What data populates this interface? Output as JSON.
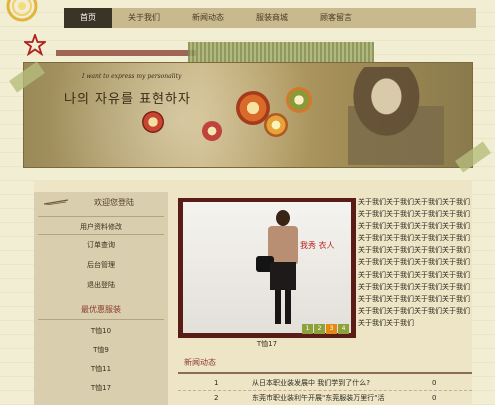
{
  "nav": {
    "items": [
      "首页",
      "关于我们",
      "新闻动态",
      "服装商城",
      "顾客留言"
    ]
  },
  "banner": {
    "tagline_small": "I want to express my personality",
    "tagline": "나의 자유를 표현하자"
  },
  "sidebar": {
    "login_title": "欢迎您登陆",
    "links": [
      "用户资料修改",
      "订单查询",
      "后台管理",
      "退出登陆"
    ],
    "rec_title": "最优惠服装",
    "products": [
      "T恤10",
      "T恤9",
      "T恤11",
      "T恤17"
    ]
  },
  "featured": {
    "caption": "T恤17",
    "watermark": "我秀 衣人",
    "pager": [
      "1",
      "2",
      "3",
      "4"
    ]
  },
  "about": {
    "text": "关于我们关于我们关于我们关于我们关于我们关于我们关于我们关于我们关于我们关于我们关于我们关于我们关于我们关于我们关于我们关于我们关于我们关于我们关于我们关于我们关于我们关于我们关于我们关于我们关于我们关于我们关于我们关于我们关于我们关于我们关于我们关于我们关于我们关于我们关于我们关于我们关于我们关于我们关于我们关于我们关于我们关于我们"
  },
  "news": {
    "title": "新闻动态",
    "rows": [
      {
        "no": "1",
        "title": "从日本职业装发展中 我们学到了什么?",
        "count": "0"
      },
      {
        "no": "2",
        "title": "东莞市职业装利午开展\"东莞服装万里行\"活",
        "count": "0"
      }
    ]
  },
  "colors": {
    "nav_active": "#3a3326",
    "accent_red": "#8b3a2a",
    "pager_green": "#8fa13a",
    "pager_active": "#e48a14"
  }
}
